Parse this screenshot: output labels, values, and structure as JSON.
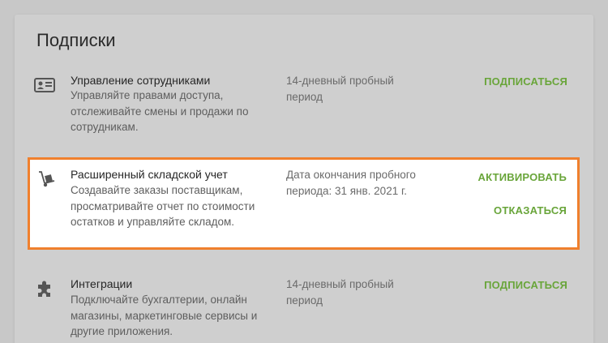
{
  "page": {
    "title": "Подписки"
  },
  "colors": {
    "accent": "#69a53a",
    "highlight_border": "#f0802d"
  },
  "subscriptions": [
    {
      "icon": "id-card-icon",
      "name": "Управление сотрудниками",
      "description": "Управляйте правами доступа, отслеживайте смены и продажи по сотрудникам.",
      "period": "14-дневный пробный период",
      "actions": [
        "ПОДПИСАТЬСЯ"
      ]
    },
    {
      "icon": "hand-truck-icon",
      "name": "Расширенный складской учет",
      "description": "Создавайте заказы поставщикам, просматривайте отчет по стоимости остатков и управляйте складом.",
      "period": "Дата окончания пробного периода: 31 янв. 2021 г.",
      "actions": [
        "АКТИВИРОВАТЬ",
        "ОТКАЗАТЬСЯ"
      ]
    },
    {
      "icon": "puzzle-icon",
      "name": "Интеграции",
      "description": "Подключайте бухгалтерии, онлайн магазины, маркетинговые сервисы и другие приложения.",
      "period": "14-дневный пробный период",
      "actions": [
        "ПОДПИСАТЬСЯ"
      ]
    }
  ]
}
